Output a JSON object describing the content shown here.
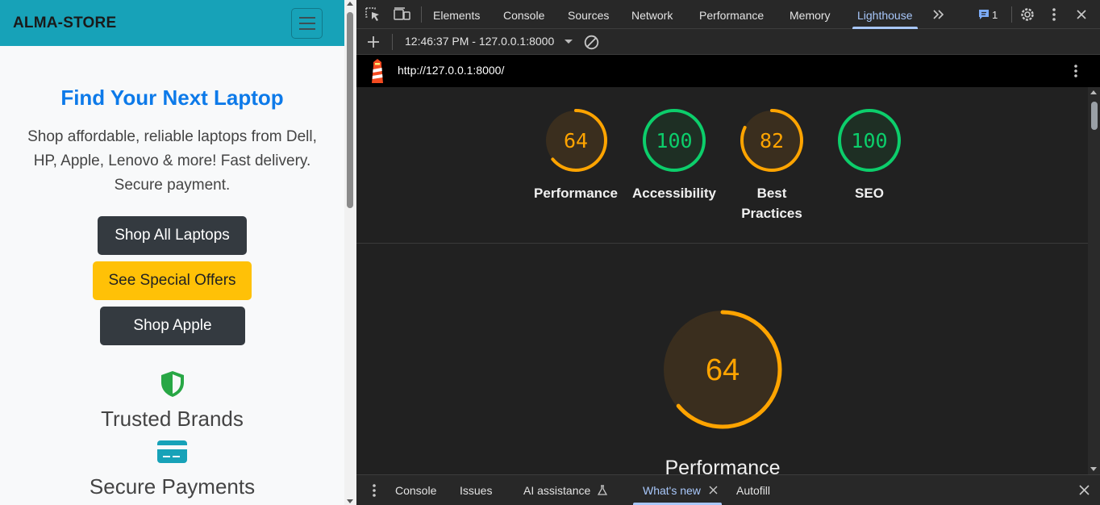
{
  "site": {
    "brand": "ALMA-STORE",
    "hero": {
      "title": "Find Your Next Laptop",
      "text": "Shop affordable, reliable laptops from Dell, HP, Apple, Lenovo & more! Fast delivery. Secure payment."
    },
    "buttons": {
      "shop_all": "Shop All Laptops",
      "offers": "See Special Offers",
      "apple": "Shop Apple"
    },
    "features": [
      {
        "icon": "shield-icon",
        "title": "Trusted Brands"
      },
      {
        "icon": "credit-card-icon",
        "title": "Secure Payments"
      }
    ],
    "colors": {
      "navbar": "#17a2b8",
      "title": "#0d7ae9",
      "dark_button": "#343a40",
      "warning_button": "#ffc107",
      "shield": "#28a745",
      "card": "#17a2b8"
    }
  },
  "devtools": {
    "tabs": [
      "Elements",
      "Console",
      "Sources",
      "Network",
      "Performance",
      "Memory",
      "Lighthouse"
    ],
    "active_tab": "Lighthouse",
    "issues_count": "1",
    "toolbar": {
      "report": "12:46:37 PM - 127.0.0.1:8000"
    },
    "url": "http://127.0.0.1:8000/",
    "scores": [
      {
        "label": "Performance",
        "value": "64",
        "score": 0.64,
        "color": "#ffa400"
      },
      {
        "label": "Accessibility",
        "value": "100",
        "score": 1.0,
        "color": "#0cce6b"
      },
      {
        "label": "Best Practices",
        "value": "82",
        "score": 0.82,
        "color": "#ffa400"
      },
      {
        "label": "SEO",
        "value": "100",
        "score": 1.0,
        "color": "#0cce6b"
      }
    ],
    "big_gauge": {
      "label": "Performance",
      "value": "64",
      "score": 0.64
    },
    "drawer": {
      "tabs": [
        "Console",
        "Issues",
        "AI assistance",
        "What's new",
        "Autofill"
      ],
      "active": "What's new"
    }
  }
}
